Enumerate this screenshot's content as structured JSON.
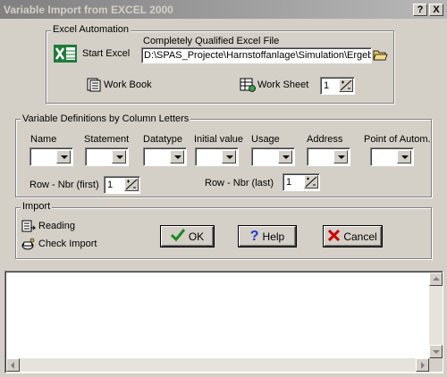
{
  "window": {
    "title": "Variable Import from EXCEL 2000",
    "help_btn": "?",
    "close_btn": "X"
  },
  "excel_automation": {
    "group_label": "Excel Automation",
    "start_label": "Start Excel",
    "file_label": "Completely Qualified Excel File",
    "file_value": "D:\\SPAS_Projecte\\Harnstoffanlage\\Simulation\\Ergebnisse.xls",
    "workbook_label": "Work Book",
    "worksheet_label": "Work Sheet",
    "worksheet_value": "1"
  },
  "variable_definitions": {
    "group_label": "Variable Definitions by Column Letters",
    "columns": [
      {
        "label": "Name",
        "value": ""
      },
      {
        "label": "Statement",
        "value": ""
      },
      {
        "label": "Datatype",
        "value": ""
      },
      {
        "label": "Initial value",
        "value": ""
      },
      {
        "label": "Usage",
        "value": ""
      },
      {
        "label": "Address",
        "value": ""
      },
      {
        "label": "Point of Autom.",
        "value": ""
      }
    ],
    "row_first_label": "Row - Nbr (first)",
    "row_first_value": "1",
    "row_last_label": "Row - Nbr (last)",
    "row_last_value": "1"
  },
  "import": {
    "group_label": "Import",
    "reading_label": "Reading",
    "check_label": "Check Import",
    "ok_label": "OK",
    "help_label": "Help",
    "cancel_label": "Cancel"
  },
  "log": {
    "text": ""
  },
  "colors": {
    "title_gradient_start": "#808080",
    "title_gradient_end": "#b8b8b8",
    "face": "#d4d0c8",
    "ok_check": "#1a8a1a",
    "cancel_x": "#cc0000",
    "help_q": "#1a3acc",
    "excel_green": "#1f7a3a"
  }
}
